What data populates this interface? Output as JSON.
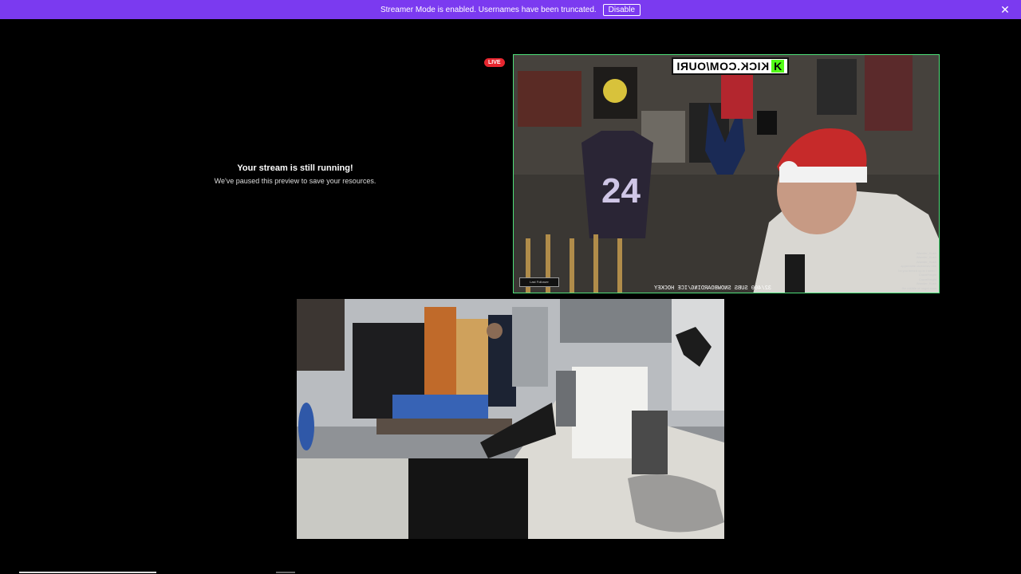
{
  "banner": {
    "message": "Streamer Mode is enabled. Usernames have been truncated.",
    "disable_label": "Disable",
    "close_icon": "close-icon",
    "color": "#7b3af0"
  },
  "paused_preview": {
    "title": "Your stream is still running!",
    "subtitle": "We've paused this preview to save your resources."
  },
  "live_badge": "LIVE",
  "top_stream": {
    "overlay_brand": "KICK.COM/OURI",
    "overlay_brand_letter": "K",
    "subs_line": "32/400 SUBS SNOWBOARDING/ICE HOCKEY",
    "border_color": "#4ee07a",
    "follower_tile": "Last Follower",
    "chat_lines": [
      "Wander_Kush",
      "Wander_Kush",
      "Wander_Kush",
      "appreciate ravennstv oke",
      "lol you tinned up in t seen !",
      "CrazeHeight",
      "CrazeHeight",
      "Wander_Kush",
      "the middle of ongol cous"
    ]
  },
  "bottom_stream": {
    "scene": "kitchen-camera-feed"
  }
}
